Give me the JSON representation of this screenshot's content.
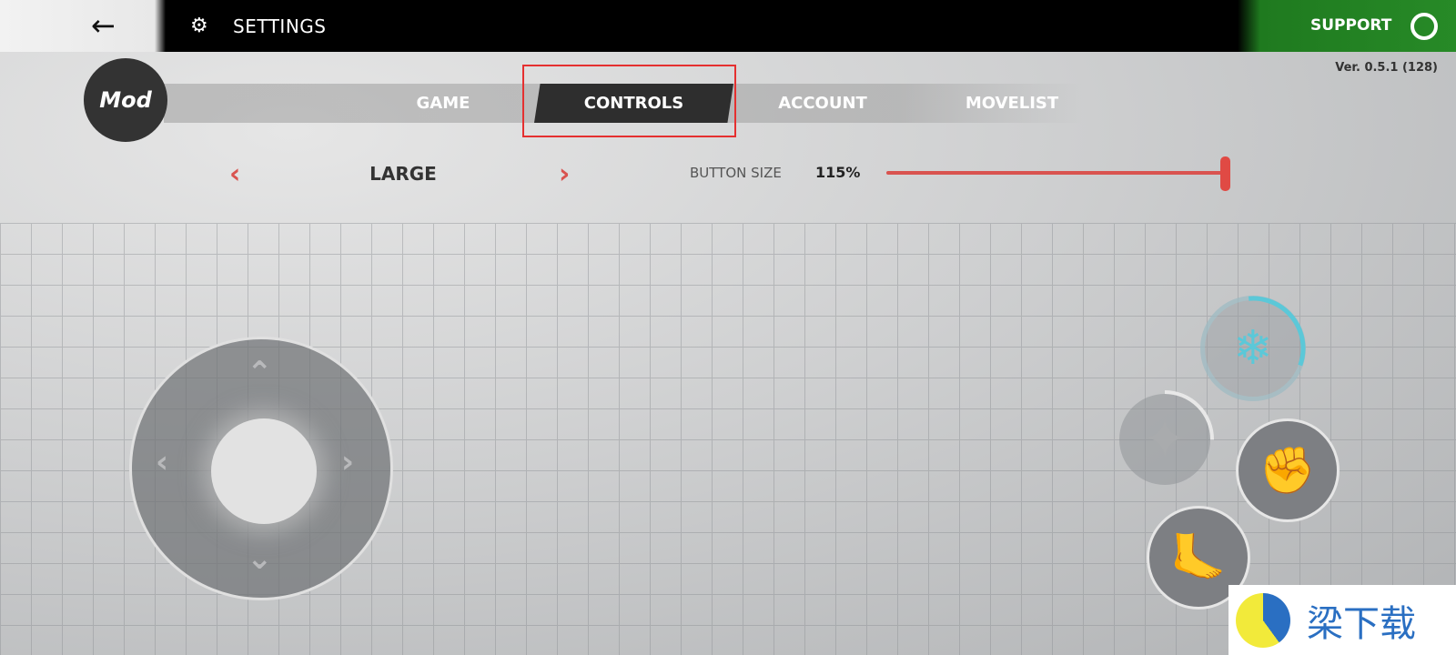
{
  "header": {
    "back_icon": "arrow-left-icon",
    "settings_icon": "gear-icon",
    "title": "SETTINGS",
    "support_label": "SUPPORT",
    "support_icon": "headset-icon"
  },
  "version": "Ver. 0.5.1 (128)",
  "logo": "Mod",
  "tabs": [
    {
      "label": "GAME"
    },
    {
      "label": "CONTROLS",
      "active": true
    },
    {
      "label": "ACCOUNT"
    },
    {
      "label": "MOVELIST"
    }
  ],
  "layout_selector": {
    "value": "LARGE",
    "prev_icon": "chevron-left-icon",
    "next_icon": "chevron-right-icon"
  },
  "button_size": {
    "label": "BUTTON SIZE",
    "value": "115%",
    "slider_fraction": 1.0
  },
  "action_buttons": [
    {
      "name": "special",
      "icon": "flame-icon"
    },
    {
      "name": "throw",
      "icon": "shuriken-icon"
    },
    {
      "name": "punch",
      "icon": "fist-icon"
    },
    {
      "name": "kick",
      "icon": "foot-icon"
    }
  ],
  "colors": {
    "accent": "#d9534f",
    "support_bg": "#278a27",
    "special": "#5bc8d8",
    "highlight_box": "#e53030"
  },
  "watermark": "梁下载"
}
